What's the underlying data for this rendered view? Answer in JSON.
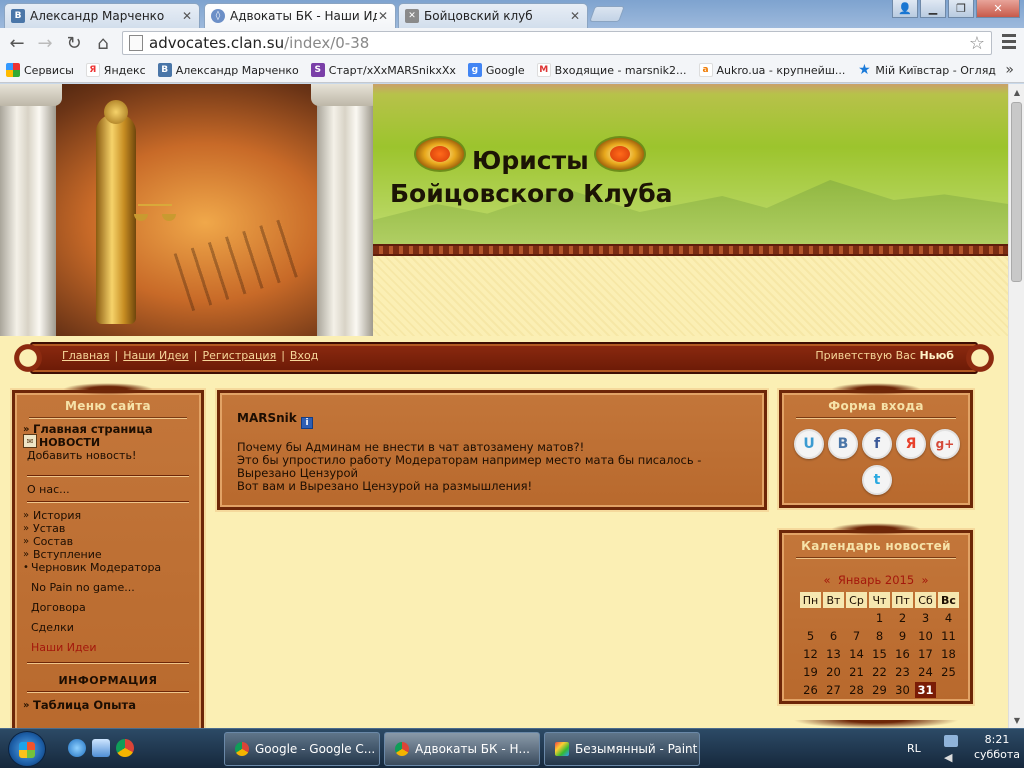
{
  "browser": {
    "tabs": [
      {
        "title": "Александр Марченко",
        "icon": "vk-icon",
        "active": false
      },
      {
        "title": "Адвокаты БК - Наши Идеи",
        "icon": "site-icon",
        "active": true
      },
      {
        "title": "Бойцовский клуб",
        "icon": "fightclub-icon",
        "active": false
      }
    ],
    "url_host": "advocates.clan.su",
    "url_path": "/index/0-38",
    "bookmarks": [
      {
        "label": "Сервисы",
        "icon": "apps-icon"
      },
      {
        "label": "Яндекс",
        "icon": "yandex-icon"
      },
      {
        "label": "Александр Марченко",
        "icon": "vk-icon"
      },
      {
        "label": "Старт/хХхMARSnikxXx",
        "icon": "s-icon"
      },
      {
        "label": "Google",
        "icon": "google-icon"
      },
      {
        "label": "Входящие - marsnik2...",
        "icon": "gmail-icon"
      },
      {
        "label": "Aukro.ua - крупнейш...",
        "icon": "aukro-icon"
      },
      {
        "label": "Мій Київстар - Огляд",
        "icon": "kyivstar-icon"
      }
    ],
    "more_label": "»"
  },
  "site": {
    "title_line1": "Юристы",
    "title_line2": "Бойцовского Клуба"
  },
  "nav": {
    "links": [
      "Главная",
      "Наши Идеи",
      "Регистрация",
      "Вход"
    ],
    "separator": "|",
    "greeting": "Приветствую Вас",
    "username": "Ньюб"
  },
  "menu": {
    "title": "Меню сайта",
    "group1": [
      {
        "label": "Главная страница",
        "bold": true,
        "bullet": "»"
      },
      {
        "label": "НОВОСТИ",
        "bold": true,
        "bullet": ""
      },
      {
        "label": "Добавить новость!",
        "bold": false,
        "bullet": ""
      }
    ],
    "group2": [
      {
        "label": "О нас...",
        "bullet": ""
      }
    ],
    "group3": [
      {
        "label": "История",
        "bullet": "»"
      },
      {
        "label": "Устав",
        "bullet": "»"
      },
      {
        "label": "Состав",
        "bullet": "»"
      },
      {
        "label": "Вступление",
        "bullet": "»"
      },
      {
        "label": "Черновик Модератора",
        "bullet": "•"
      }
    ],
    "group4": [
      {
        "label": "No Pain no game...",
        "red": false
      },
      {
        "label": "Договора",
        "red": false
      },
      {
        "label": "Сделки",
        "red": false
      },
      {
        "label": "Наши Идеи",
        "red": true
      }
    ],
    "info_title": "ИНФОРМАЦИЯ",
    "group5": [
      {
        "label": "Таблица Опыта",
        "bullet": "»"
      }
    ]
  },
  "post": {
    "author": "MARSnik",
    "info_icon": "i",
    "body": "Почему бы Админам не внести в чат автозамену матов?!\nЭто бы упростило работу Модераторам например место мата бы писалось - Вырезано Цензурой\nВот вам и Вырезано Цензурой на размышления!"
  },
  "login": {
    "title": "Форма входа",
    "socials": [
      {
        "name": "ucoz",
        "label": "U",
        "color": "#3b9bd1"
      },
      {
        "name": "vkontakte",
        "label": "В",
        "color": "#4a76a8"
      },
      {
        "name": "facebook",
        "label": "f",
        "color": "#3b5998"
      },
      {
        "name": "yandex",
        "label": "Я",
        "color": "#e8412c"
      },
      {
        "name": "google-plus",
        "label": "g+",
        "color": "#d54a3a"
      },
      {
        "name": "twitter",
        "label": "t",
        "color": "#2aa9e0"
      }
    ]
  },
  "calendar": {
    "title": "Календарь новостей",
    "prev": "«",
    "next": "»",
    "month": "Январь 2015",
    "weekdays": [
      "Пн",
      "Вт",
      "Ср",
      "Чт",
      "Пт",
      "Сб",
      "Вс"
    ],
    "weeks": [
      [
        "",
        "",
        "",
        "1",
        "2",
        "3",
        "4"
      ],
      [
        "5",
        "6",
        "7",
        "8",
        "9",
        "10",
        "11"
      ],
      [
        "12",
        "13",
        "14",
        "15",
        "16",
        "17",
        "18"
      ],
      [
        "19",
        "20",
        "21",
        "22",
        "23",
        "24",
        "25"
      ],
      [
        "26",
        "27",
        "28",
        "29",
        "30",
        "31",
        ""
      ]
    ],
    "today": "31"
  },
  "taskbar": {
    "items": [
      {
        "label": "Google - Google C...",
        "active": false
      },
      {
        "label": "Адвокаты БК - Н...",
        "active": true
      },
      {
        "label": "Безымянный - Paint",
        "active": false
      }
    ],
    "lang": "RL",
    "time": "8:21",
    "day": "суббота"
  },
  "colors": {
    "nav_bg": "#8c2a10",
    "panel_bg": "#c3763a",
    "page_bg": "#fbefb4",
    "today_bg": "#7a1c06"
  }
}
